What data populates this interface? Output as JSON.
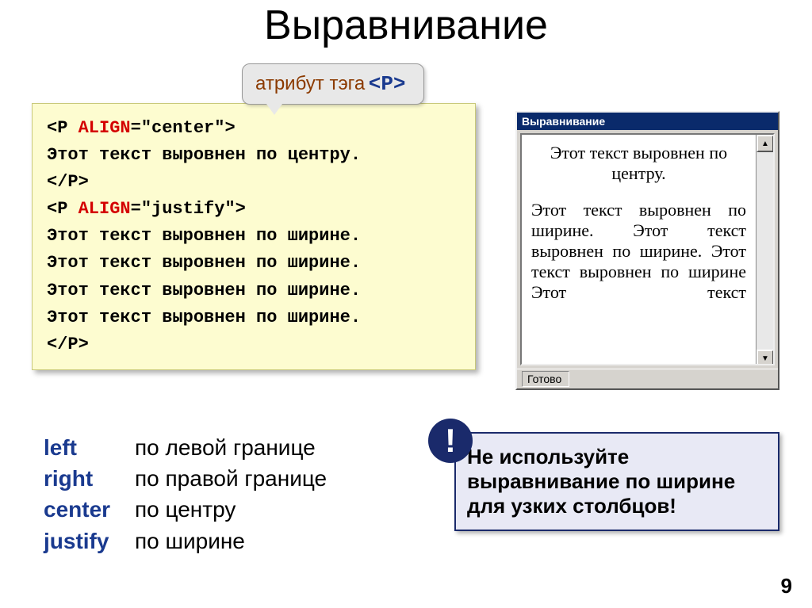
{
  "title": "Выравнивание",
  "callout": {
    "text": "атрибут тэга",
    "tag": "<P>"
  },
  "code": {
    "l1_open": "<P ",
    "l1_attr": "ALIGN",
    "l1_rest": "=\"center\">",
    "l2": "Этот текст выровнен по центру.",
    "l3": "</P>",
    "l4_open": "<P ",
    "l4_attr": "ALIGN",
    "l4_rest": "=\"justify\">",
    "l5": "Этот текст выровнен по ширине.",
    "l6": "Этот текст выровнен по ширине.",
    "l7": "Этот текст выровнен по ширине.",
    "l8": "Этот текст выровнен по ширине.",
    "l9": "</P>"
  },
  "preview": {
    "title": "Выравнивание",
    "p_center": "Этот текст выровнен по центру.",
    "p_justify": "Этот текст выровнен по ширине. Этот текст выровнен по ширине. Этот текст выровнен по ширине Этот текст",
    "status": "Готово"
  },
  "options": {
    "left_kw": "left",
    "left_desc": "по левой границе",
    "right_kw": "right",
    "right_desc": "по правой границе",
    "center_kw": "center",
    "center_desc": "по центру",
    "justify_kw": "justify",
    "justify_desc": "по ширине"
  },
  "note": {
    "badge": "!",
    "text": "Не используйте выравнивание по ширине для узких столбцов!"
  },
  "pagenum": "9"
}
